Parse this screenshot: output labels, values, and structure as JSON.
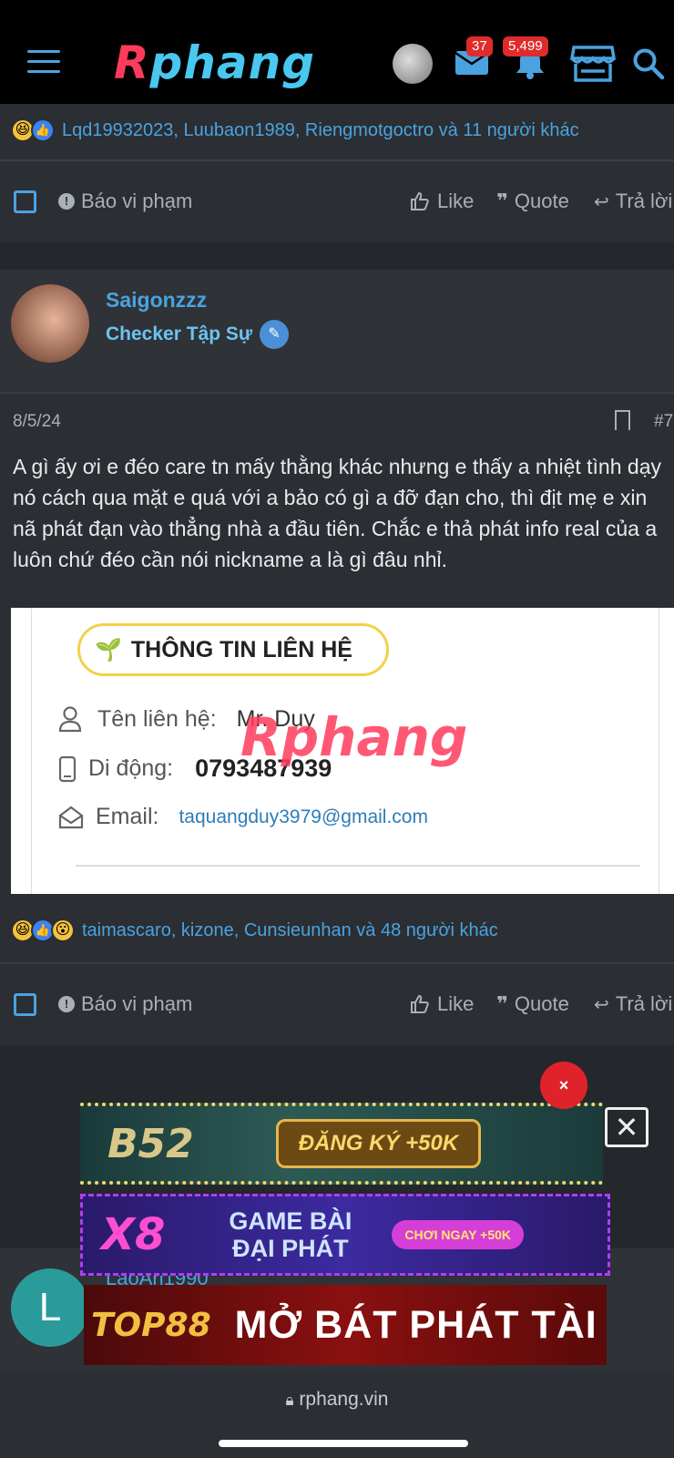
{
  "nav": {
    "logo_first": "R",
    "logo_rest": "phang",
    "messages_count": "37",
    "alerts_count": "5,499"
  },
  "prev_post": {
    "reactions_text": "Lqd19932023, Luubaon1989, Riengmotgoctro và 11 người khác"
  },
  "actions": {
    "report": "Báo vi phạm",
    "like": "Like",
    "quote": "Quote",
    "reply": "Trả lời"
  },
  "post": {
    "username": "Saigonzzz",
    "user_title": "Checker Tập Sự",
    "date": "8/5/24",
    "post_number": "#7",
    "body": "A gì ấy ơi e đéo care tn mấy thằng khác nhưng e thấy a nhiệt tình dạy nó cách qua mặt e quá với a bảo có gì a đỡ đạn cho, thì địt mẹ e xin nã phát đạn vào thẳng nhà a đầu tiên. Chắc e thả phát info real của a luôn chứ đéo cần nói nickname a là gì đâu nhỉ.",
    "embed": {
      "title": "THÔNG TIN LIÊN HỆ",
      "name_label": "Tên liên hệ:",
      "name_value": "Mr. Duy",
      "phone_label": "Di động:",
      "phone_value": "0793487939",
      "email_label": "Email:",
      "email_value": "taquangduy3979@gmail.com",
      "watermark": "Rphang"
    },
    "reactions_text": "taimascaro, kizone, Cunsieunhan và 48 người khác"
  },
  "ads": {
    "close_red": "×",
    "close_box": "✕",
    "b52_logo": "B52",
    "b52_cta": "ĐĂNG KÝ +50K",
    "x8_logo": "X8",
    "x8_text_1": "GAME BÀI",
    "x8_text_2": "ĐẠI PHÁT",
    "x8_cta": "CHƠI NGAY +50K",
    "top88_logo": "TOP88",
    "top88_text": "MỞ BÁT PHÁT TÀI"
  },
  "next_post": {
    "avatar_letter": "L",
    "username": "LaoAn1990"
  },
  "browser": {
    "url": "rphang.vin"
  },
  "colors": {
    "accent": "#4aa3e0",
    "background": "#2b2e33",
    "badge": "#e02b2b"
  }
}
